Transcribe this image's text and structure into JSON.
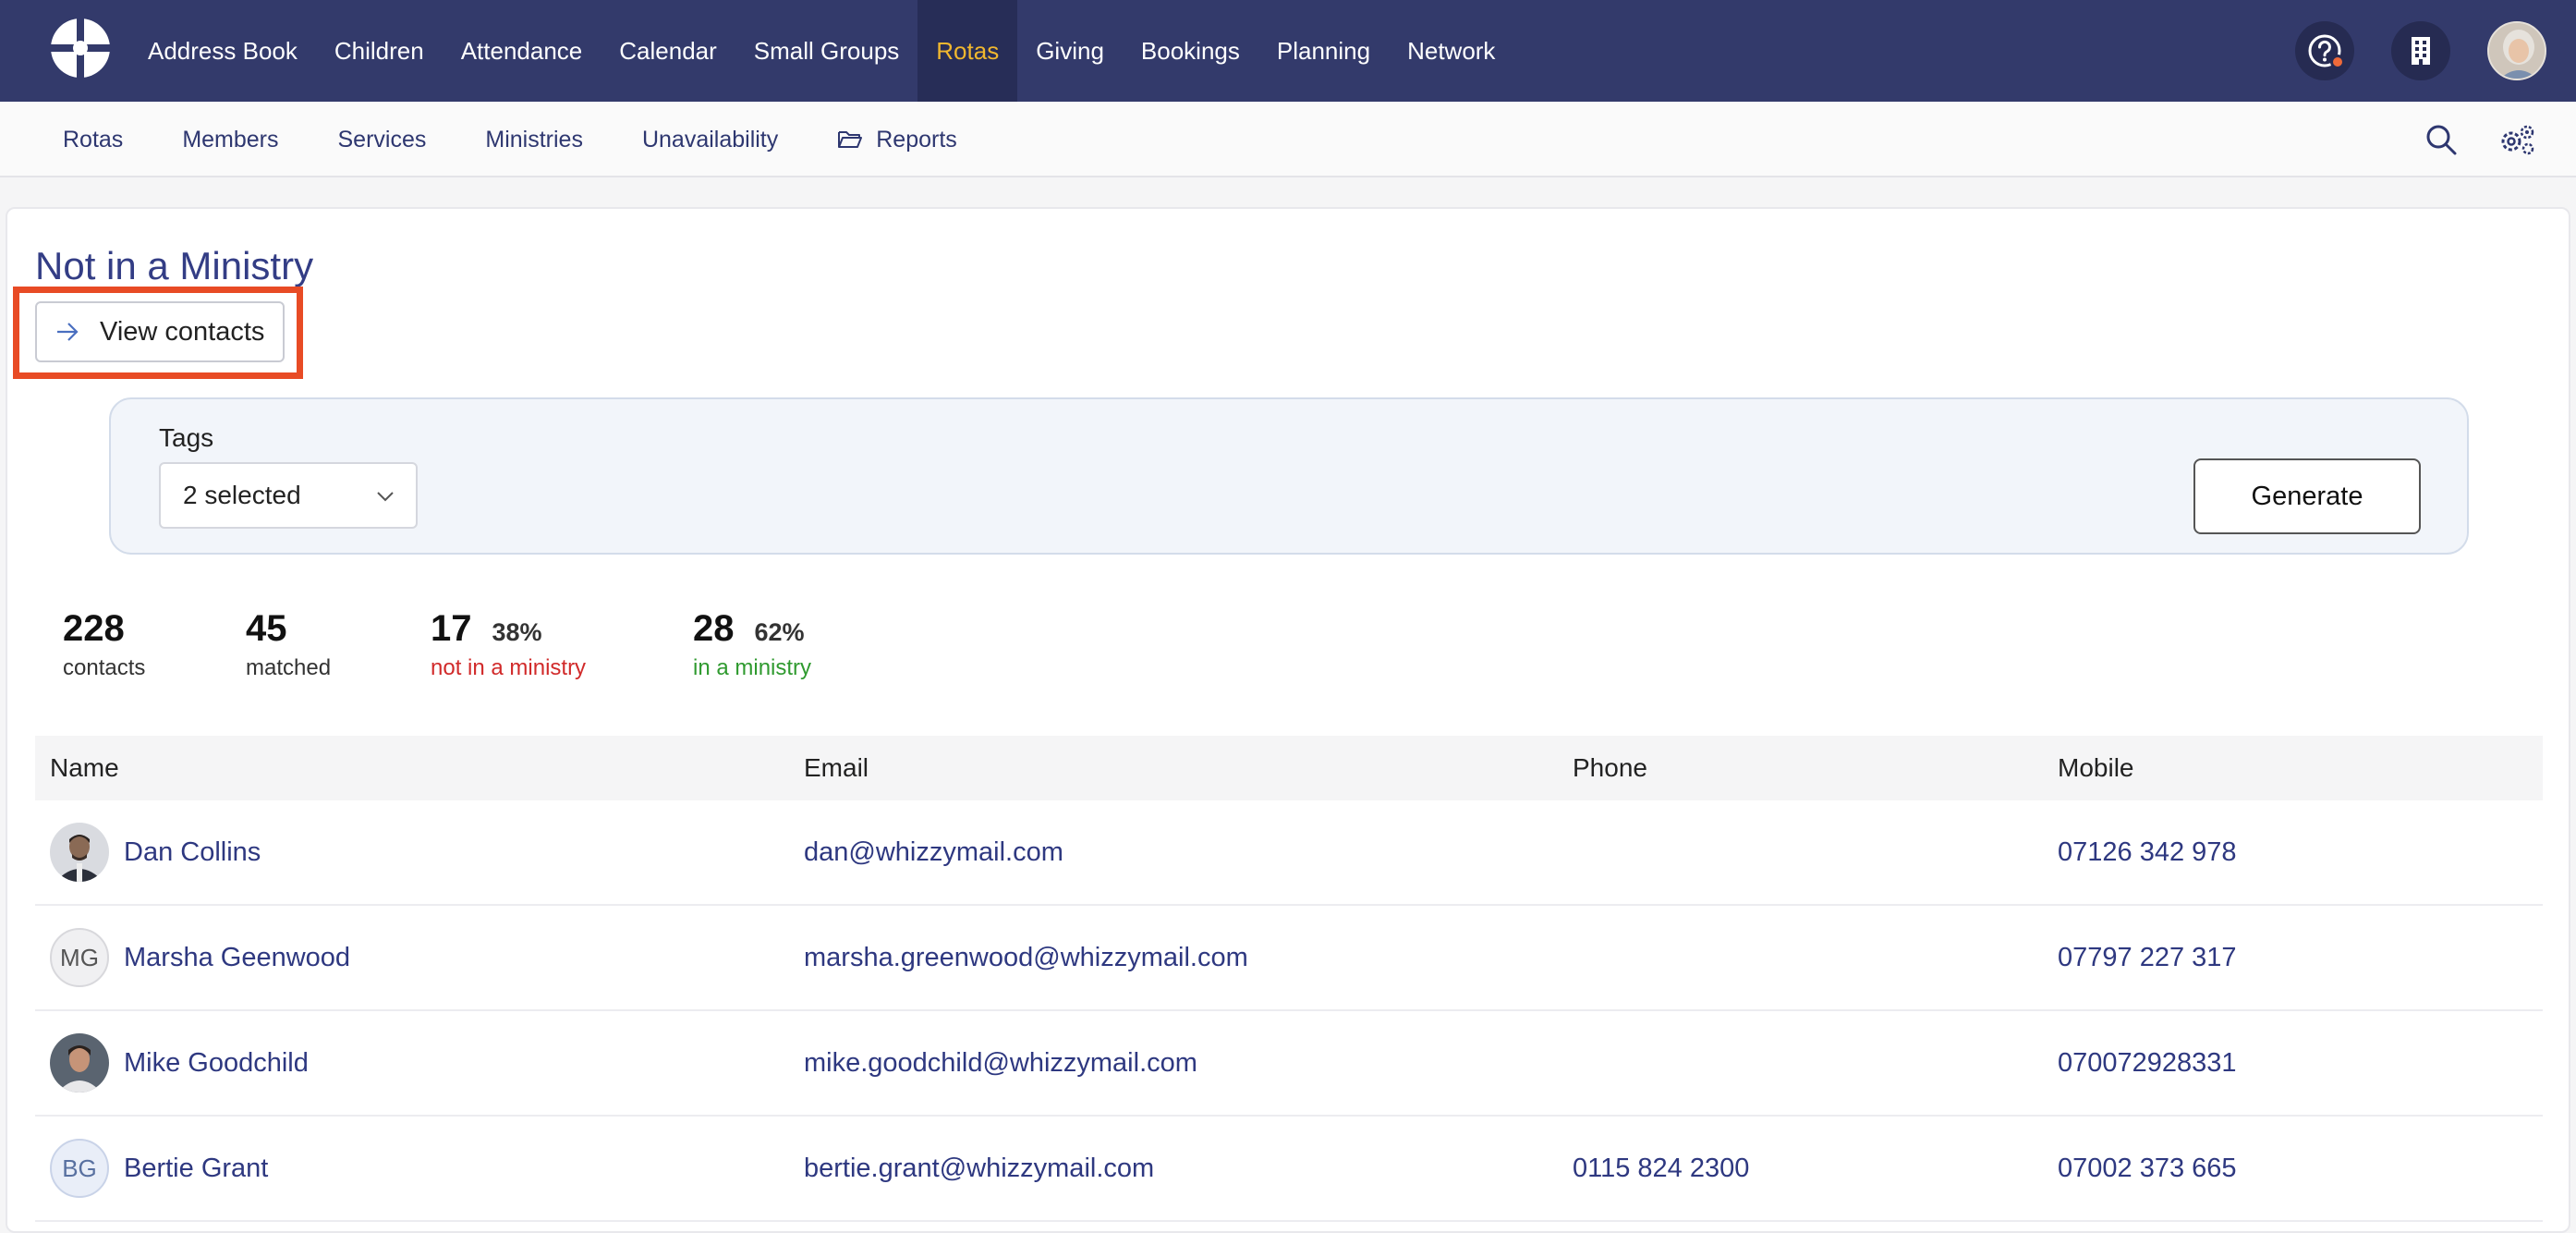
{
  "topnav": {
    "items": [
      "Address Book",
      "Children",
      "Attendance",
      "Calendar",
      "Small Groups",
      "Rotas",
      "Giving",
      "Bookings",
      "Planning",
      "Network"
    ],
    "active": "Rotas",
    "colors": {
      "bg": "#333a6b",
      "active_bg": "#272d57",
      "active_text": "#f0b72f"
    }
  },
  "subnav": {
    "items": [
      "Rotas",
      "Members",
      "Services",
      "Ministries",
      "Unavailability",
      "Reports"
    ]
  },
  "page": {
    "title": "Not in a Ministry",
    "view_contacts": "View contacts"
  },
  "filter": {
    "tags_label": "Tags",
    "tags_value": "2 selected",
    "generate": "Generate"
  },
  "stats": {
    "contacts": {
      "num": "228",
      "caption": "contacts"
    },
    "matched": {
      "num": "45",
      "caption": "matched"
    },
    "not_in": {
      "num": "17",
      "pct": "38%",
      "caption": "not in a ministry",
      "color": "#d12a2a"
    },
    "in": {
      "num": "28",
      "pct": "62%",
      "caption": "in a ministry",
      "color": "#2f9a2f"
    }
  },
  "table": {
    "headers": {
      "name": "Name",
      "email": "Email",
      "phone": "Phone",
      "mobile": "Mobile"
    },
    "rows": [
      {
        "name": "Dan Collins",
        "email": "dan@whizzymail.com",
        "phone": "",
        "mobile": "07126 342 978",
        "avatar": "photo"
      },
      {
        "name": "Marsha Geenwood",
        "email": "marsha.greenwood@whizzymail.com",
        "phone": "",
        "mobile": "07797 227 317",
        "avatar": "MG"
      },
      {
        "name": "Mike Goodchild",
        "email": "mike.goodchild@whizzymail.com",
        "phone": "",
        "mobile": "070072928331",
        "avatar": "photo"
      },
      {
        "name": "Bertie Grant",
        "email": "bertie.grant@whizzymail.com",
        "phone": "0115 824 2300",
        "mobile": "07002 373 665",
        "avatar": "BG"
      }
    ]
  }
}
